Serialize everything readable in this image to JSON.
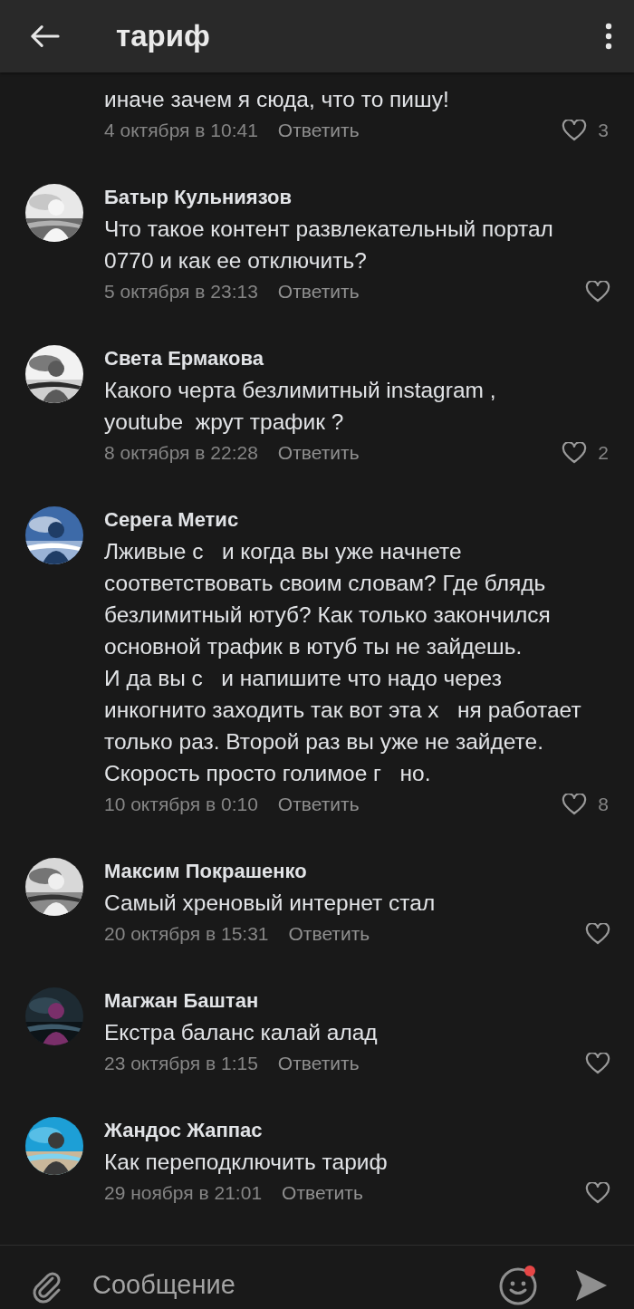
{
  "header": {
    "title": "тариф"
  },
  "comments": [
    {
      "text": "иначе зачем я сюда, что то пишу!",
      "date": "4 октября в 10:41",
      "reply": "Ответить",
      "likes": "3"
    },
    {
      "author": "Батыр Кульниязов",
      "text": "Что такое контент развлекательный портал 0770 и как ее отключить?",
      "date": "5 октября в 23:13",
      "reply": "Ответить"
    },
    {
      "author": "Света Ермакова",
      "text": "Какого черта безлимитный instagram ,\nyoutube  жрут трафик ?",
      "date": "8 октября в 22:28",
      "reply": "Ответить",
      "likes": "2"
    },
    {
      "author": "Серега Метис",
      "text": "Лживые с   и когда вы уже начнете соответствовать своим словам? Где блядь безлимитный ютуб? Как только закончился основной трафик в ютуб ты не зайдешь.\nИ да вы с   и напишите что надо через инкогнито заходить так вот эта х   ня работает только раз. Второй раз вы уже не зайдете. Скорость просто голимое г   но.",
      "date": "10 октября в 0:10",
      "reply": "Ответить",
      "likes": "8"
    },
    {
      "author": "Максим Покрашенко",
      "text": "Самый хреновый интернет стал",
      "date": "20 октября в 15:31",
      "reply": "Ответить"
    },
    {
      "author": "Магжан Баштан",
      "text": "Екстра баланс калай алад",
      "date": "23 октября в 1:15",
      "reply": "Ответить"
    },
    {
      "author": "Жандос Жаппас",
      "text": "Как переподключить тариф",
      "date": "29 ноября в 21:01",
      "reply": "Ответить"
    }
  ],
  "composer": {
    "placeholder": "Сообщение"
  }
}
